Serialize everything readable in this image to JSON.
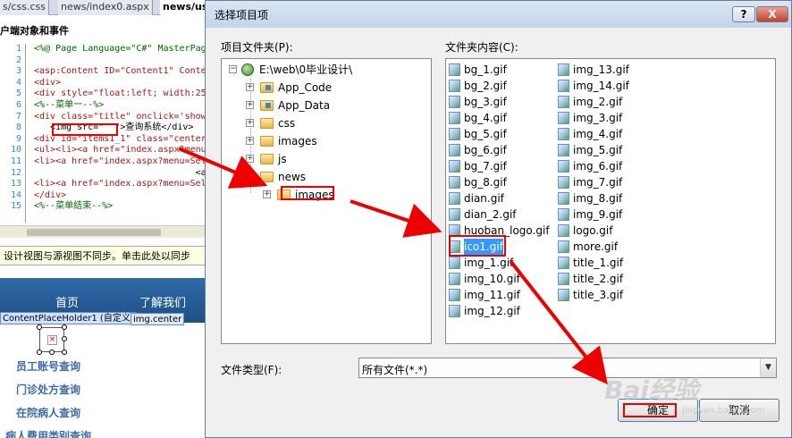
{
  "ide": {
    "tabs": [
      "s/css.css",
      "news/index0.aspx",
      "news/us"
    ],
    "header_title": "户端对象和事件",
    "code_lines": [
      {
        "n": "1",
        "text": "<%@ Page Language=\"C#\" MasterPag"
      },
      {
        "n": "2",
        "text": ""
      },
      {
        "n": "3",
        "text": "<asp:Content ID=\"Content1\" Conte"
      },
      {
        "n": "4",
        "text": "<div>"
      },
      {
        "n": "5",
        "text": "<div style=\"float:left; width:25"
      },
      {
        "n": "6",
        "text": "<%--菜单一--%>"
      },
      {
        "n": "7",
        "text": "<div class=\"title\" onclick='show"
      },
      {
        "n": "8",
        "text": "   <img src=\"  \">查询系统</div>"
      },
      {
        "n": "9",
        "text": "<div id=\"items1_1\" class=\"center"
      },
      {
        "n": "10",
        "text": "<ul><li><a href=\"index.aspx?menu"
      },
      {
        "n": "11",
        "text": "<li><a href=\"index.aspx?menu=Sel"
      },
      {
        "n": "12",
        "text": "                              <a hr"
      },
      {
        "n": "13",
        "text": "<li><a href=\"index.aspx?menu=Sel"
      },
      {
        "n": "14",
        "text": "</div>"
      },
      {
        "n": "15",
        "text": "<%--菜单结束--%>"
      }
    ],
    "infobar_text": "设计视图与源视图不同步。单击此处以同步",
    "nav_items": [
      "首页",
      "了解我们"
    ],
    "content_holder_tag": "ContentPlaceHolder1 (自定义)",
    "img_center_tag": "img.center",
    "menu_links": [
      "员工账号查询",
      "门诊处方查询",
      "在院病人查询",
      "病人费用类别查询"
    ]
  },
  "dialog": {
    "title": "选择项目项",
    "help_label": "?",
    "close_label": "X",
    "folder_label": "项目文件夹(P):",
    "contents_label": "文件夹内容(C):",
    "tree": {
      "root": "E:\\web\\0毕业设计\\",
      "items": [
        "App_Code",
        "App_Data",
        "css",
        "images",
        "js",
        "news",
        "images"
      ]
    },
    "files_col1": [
      "bg_1.gif",
      "bg_2.gif",
      "bg_3.gif",
      "bg_4.gif",
      "bg_5.gif",
      "bg_6.gif",
      "bg_7.gif",
      "bg_8.gif",
      "dian.gif",
      "dian_2.gif",
      "huoban_logo.gif",
      "ico1.gif",
      "img_1.gif",
      "img_10.gif",
      "img_11.gif",
      "img_12.gif"
    ],
    "files_col2": [
      "img_13.gif",
      "img_14.gif",
      "img_2.gif",
      "img_3.gif",
      "img_4.gif",
      "img_5.gif",
      "img_6.gif",
      "img_7.gif",
      "img_8.gif",
      "img_9.gif",
      "logo.gif",
      "more.gif",
      "title_1.gif",
      "title_2.gif",
      "title_3.gif"
    ],
    "filetype_label": "文件类型(F):",
    "filetype_value": "所有文件(*.*)",
    "ok_label": "确定",
    "cancel_label": "取消"
  },
  "watermark": {
    "text": "Bai经验",
    "sub": "jingyan.baidu.com"
  },
  "colors": {
    "annotation_red": "#e00000",
    "dialog_bg": "#f0f0f0",
    "nav_blue": "#2e6aa8"
  }
}
